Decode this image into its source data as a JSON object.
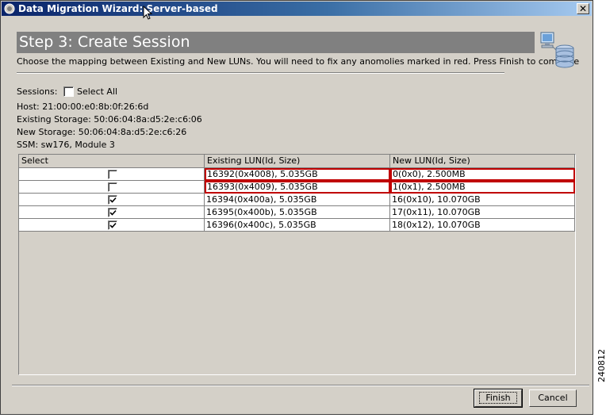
{
  "window": {
    "title": "Data Migration Wizard: Server-based",
    "close_glyph": "✕"
  },
  "step": {
    "title": "Step 3: Create Session",
    "description": "Choose the mapping between Existing and New LUNs. You will need to fix any anomolies marked in red. Press Finish to complete"
  },
  "sessions": {
    "label": "Sessions:",
    "select_all_label": "Select All",
    "select_all_checked": false
  },
  "info": {
    "host": "Host: 21:00:00:e0:8b:0f:26:6d",
    "existing_storage": "Existing Storage: 50:06:04:8a:d5:2e:c6:06",
    "new_storage": "New Storage: 50:06:04:8a:d5:2e:c6:26",
    "ssm": "SSM: sw176, Module 3"
  },
  "table": {
    "headers": [
      "Select",
      "Existing LUN(Id, Size)",
      "New LUN(Id, Size)"
    ],
    "rows": [
      {
        "selected": false,
        "existing": "16392(0x4008), 5.035GB",
        "new": "0(0x0), 2.500MB",
        "error": true
      },
      {
        "selected": false,
        "existing": "16393(0x4009), 5.035GB",
        "new": "1(0x1), 2.500MB",
        "error": true
      },
      {
        "selected": true,
        "existing": "16394(0x400a), 5.035GB",
        "new": "16(0x10), 10.070GB",
        "error": false
      },
      {
        "selected": true,
        "existing": "16395(0x400b), 5.035GB",
        "new": "17(0x11), 10.070GB",
        "error": false
      },
      {
        "selected": true,
        "existing": "16396(0x400c), 5.035GB",
        "new": "18(0x12), 10.070GB",
        "error": false
      }
    ]
  },
  "buttons": {
    "finish": "Finish",
    "cancel": "Cancel"
  },
  "figure_number": "240812",
  "colors": {
    "error_border": "#c00000",
    "title_bar_start": "#0a246a",
    "banner": "#808080"
  }
}
